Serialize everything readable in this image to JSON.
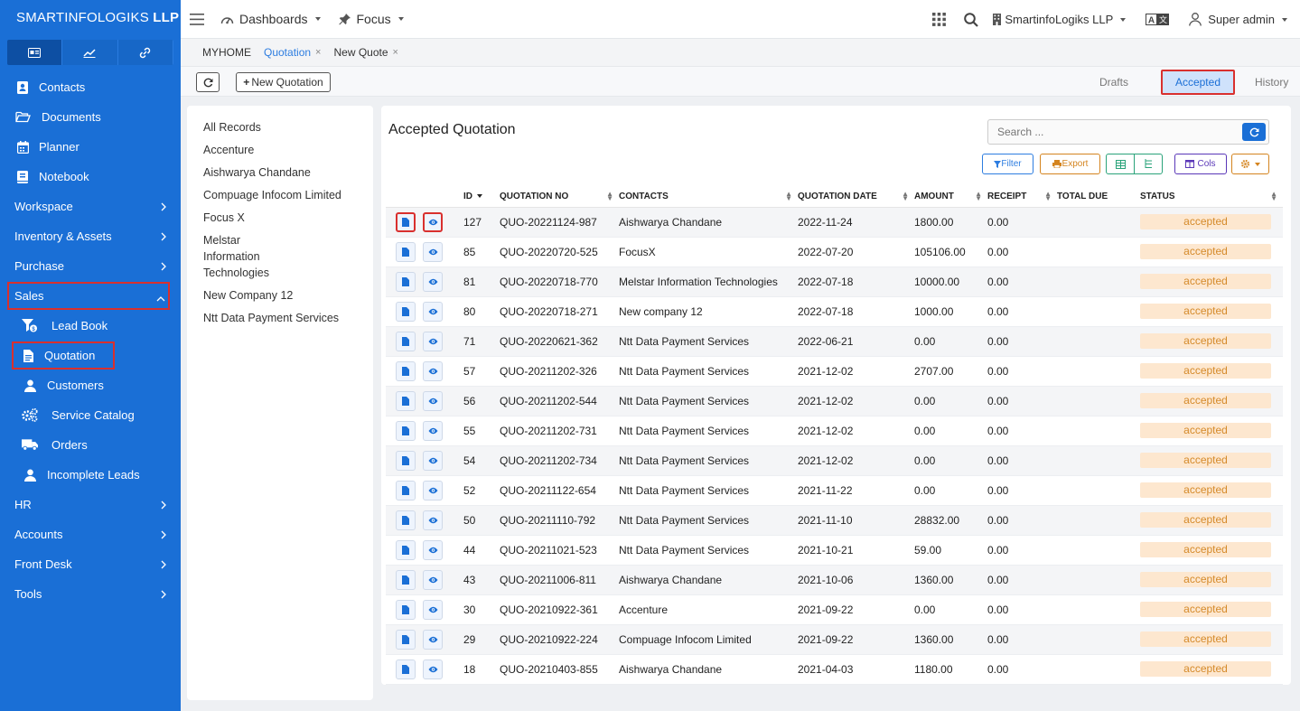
{
  "brand": {
    "name_plain": "SMARTINFOLOGIKS",
    "name_bold": "LLP"
  },
  "sidebar": {
    "items": [
      {
        "label": "Contacts",
        "icon": "contact-card-icon"
      },
      {
        "label": "Documents",
        "icon": "folder-open-icon"
      },
      {
        "label": "Planner",
        "icon": "calendar-icon"
      },
      {
        "label": "Notebook",
        "icon": "book-icon"
      },
      {
        "label": "Workspace",
        "chevron": "right"
      },
      {
        "label": "Inventory & Assets",
        "chevron": "right"
      },
      {
        "label": "Purchase",
        "chevron": "right"
      },
      {
        "label": "Sales",
        "chevron": "up"
      },
      {
        "label": "Lead Book",
        "icon": "funnel-icon"
      },
      {
        "label": "Quotation",
        "icon": "file-icon"
      },
      {
        "label": "Customers",
        "icon": "user-icon"
      },
      {
        "label": "Service Catalog",
        "icon": "gears-icon"
      },
      {
        "label": "Orders",
        "icon": "truck-icon"
      },
      {
        "label": "Incomplete Leads",
        "icon": "user-icon"
      },
      {
        "label": "HR",
        "chevron": "right"
      },
      {
        "label": "Accounts",
        "chevron": "right"
      },
      {
        "label": "Front Desk",
        "chevron": "right"
      },
      {
        "label": "Tools",
        "chevron": "right"
      }
    ]
  },
  "topbar": {
    "dashboards": "Dashboards",
    "focus": "Focus",
    "company": "SmartinfoLogiks LLP",
    "user": "Super admin"
  },
  "crumbs": {
    "home": "MYHOME",
    "quotation": "Quotation",
    "new_quote": "New Quote",
    "close": "×"
  },
  "toolbar": {
    "new_quotation": "New Quotation",
    "tab_drafts": "Drafts",
    "tab_accepted": "Accepted",
    "tab_history": "History"
  },
  "left_list": [
    "All Records",
    "Accenture",
    "Aishwarya Chandane",
    "Compuage Infocom Limited",
    "Focus X",
    "Melstar Information Technologies",
    "New Company 12",
    "Ntt Data Payment Services"
  ],
  "main": {
    "title": "Accepted Quotation",
    "search_placeholder": "Search ...",
    "filter": "Filter",
    "export": "Export",
    "cols": "Cols"
  },
  "table": {
    "headers": [
      "ID",
      "QUOTATION NO",
      "CONTACTS",
      "QUOTATION DATE",
      "AMOUNT",
      "RECEIPT",
      "TOTAL DUE",
      "STATUS"
    ],
    "rows": [
      [
        "127",
        "QUO-20221124-987",
        "Aishwarya Chandane",
        "2022-11-24",
        "1800.00",
        "0.00",
        "",
        "accepted"
      ],
      [
        "85",
        "QUO-20220720-525",
        "FocusX",
        "2022-07-20",
        "105106.00",
        "0.00",
        "",
        "accepted"
      ],
      [
        "81",
        "QUO-20220718-770",
        "Melstar Information Technologies",
        "2022-07-18",
        "10000.00",
        "0.00",
        "",
        "accepted"
      ],
      [
        "80",
        "QUO-20220718-271",
        "New company 12",
        "2022-07-18",
        "1000.00",
        "0.00",
        "",
        "accepted"
      ],
      [
        "71",
        "QUO-20220621-362",
        "Ntt Data Payment Services",
        "2022-06-21",
        "0.00",
        "0.00",
        "",
        "accepted"
      ],
      [
        "57",
        "QUO-20211202-326",
        "Ntt Data Payment Services",
        "2021-12-02",
        "2707.00",
        "0.00",
        "",
        "accepted"
      ],
      [
        "56",
        "QUO-20211202-544",
        "Ntt Data Payment Services",
        "2021-12-02",
        "0.00",
        "0.00",
        "",
        "accepted"
      ],
      [
        "55",
        "QUO-20211202-731",
        "Ntt Data Payment Services",
        "2021-12-02",
        "0.00",
        "0.00",
        "",
        "accepted"
      ],
      [
        "54",
        "QUO-20211202-734",
        "Ntt Data Payment Services",
        "2021-12-02",
        "0.00",
        "0.00",
        "",
        "accepted"
      ],
      [
        "52",
        "QUO-20211122-654",
        "Ntt Data Payment Services",
        "2021-11-22",
        "0.00",
        "0.00",
        "",
        "accepted"
      ],
      [
        "50",
        "QUO-20211110-792",
        "Ntt Data Payment Services",
        "2021-11-10",
        "28832.00",
        "0.00",
        "",
        "accepted"
      ],
      [
        "44",
        "QUO-20211021-523",
        "Ntt Data Payment Services",
        "2021-10-21",
        "59.00",
        "0.00",
        "",
        "accepted"
      ],
      [
        "43",
        "QUO-20211006-811",
        "Aishwarya Chandane",
        "2021-10-06",
        "1360.00",
        "0.00",
        "",
        "accepted"
      ],
      [
        "30",
        "QUO-20210922-361",
        "Accenture",
        "2021-09-22",
        "0.00",
        "0.00",
        "",
        "accepted"
      ],
      [
        "29",
        "QUO-20210922-224",
        "Compuage Infocom Limited",
        "2021-09-22",
        "1360.00",
        "0.00",
        "",
        "accepted"
      ],
      [
        "18",
        "QUO-20210403-855",
        "Aishwarya Chandane",
        "2021-04-03",
        "1180.00",
        "0.00",
        "",
        "accepted"
      ]
    ]
  },
  "colors": {
    "sidebar": "#1a6fd6",
    "accent": "#1a6fd6",
    "badge_bg": "#fde7cf",
    "badge_text": "#d58a2a",
    "highlight": "#d9302e"
  }
}
